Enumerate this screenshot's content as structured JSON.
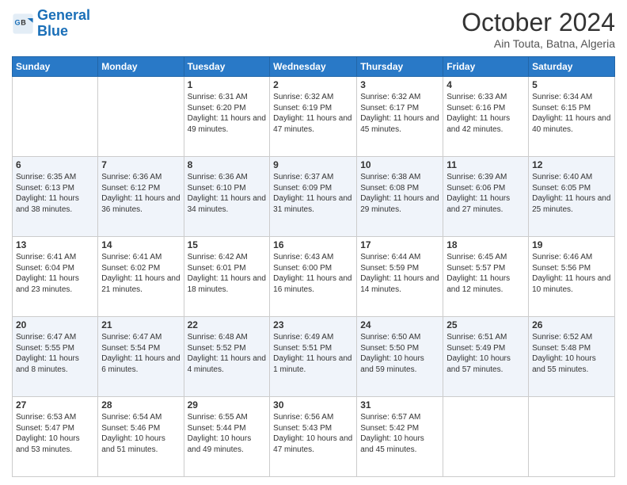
{
  "logo": {
    "line1": "General",
    "line2": "Blue"
  },
  "header": {
    "month": "October 2024",
    "location": "Ain Touta, Batna, Algeria"
  },
  "weekdays": [
    "Sunday",
    "Monday",
    "Tuesday",
    "Wednesday",
    "Thursday",
    "Friday",
    "Saturday"
  ],
  "weeks": [
    [
      {
        "day": "",
        "content": ""
      },
      {
        "day": "",
        "content": ""
      },
      {
        "day": "1",
        "content": "Sunrise: 6:31 AM\nSunset: 6:20 PM\nDaylight: 11 hours and 49 minutes."
      },
      {
        "day": "2",
        "content": "Sunrise: 6:32 AM\nSunset: 6:19 PM\nDaylight: 11 hours and 47 minutes."
      },
      {
        "day": "3",
        "content": "Sunrise: 6:32 AM\nSunset: 6:17 PM\nDaylight: 11 hours and 45 minutes."
      },
      {
        "day": "4",
        "content": "Sunrise: 6:33 AM\nSunset: 6:16 PM\nDaylight: 11 hours and 42 minutes."
      },
      {
        "day": "5",
        "content": "Sunrise: 6:34 AM\nSunset: 6:15 PM\nDaylight: 11 hours and 40 minutes."
      }
    ],
    [
      {
        "day": "6",
        "content": "Sunrise: 6:35 AM\nSunset: 6:13 PM\nDaylight: 11 hours and 38 minutes."
      },
      {
        "day": "7",
        "content": "Sunrise: 6:36 AM\nSunset: 6:12 PM\nDaylight: 11 hours and 36 minutes."
      },
      {
        "day": "8",
        "content": "Sunrise: 6:36 AM\nSunset: 6:10 PM\nDaylight: 11 hours and 34 minutes."
      },
      {
        "day": "9",
        "content": "Sunrise: 6:37 AM\nSunset: 6:09 PM\nDaylight: 11 hours and 31 minutes."
      },
      {
        "day": "10",
        "content": "Sunrise: 6:38 AM\nSunset: 6:08 PM\nDaylight: 11 hours and 29 minutes."
      },
      {
        "day": "11",
        "content": "Sunrise: 6:39 AM\nSunset: 6:06 PM\nDaylight: 11 hours and 27 minutes."
      },
      {
        "day": "12",
        "content": "Sunrise: 6:40 AM\nSunset: 6:05 PM\nDaylight: 11 hours and 25 minutes."
      }
    ],
    [
      {
        "day": "13",
        "content": "Sunrise: 6:41 AM\nSunset: 6:04 PM\nDaylight: 11 hours and 23 minutes."
      },
      {
        "day": "14",
        "content": "Sunrise: 6:41 AM\nSunset: 6:02 PM\nDaylight: 11 hours and 21 minutes."
      },
      {
        "day": "15",
        "content": "Sunrise: 6:42 AM\nSunset: 6:01 PM\nDaylight: 11 hours and 18 minutes."
      },
      {
        "day": "16",
        "content": "Sunrise: 6:43 AM\nSunset: 6:00 PM\nDaylight: 11 hours and 16 minutes."
      },
      {
        "day": "17",
        "content": "Sunrise: 6:44 AM\nSunset: 5:59 PM\nDaylight: 11 hours and 14 minutes."
      },
      {
        "day": "18",
        "content": "Sunrise: 6:45 AM\nSunset: 5:57 PM\nDaylight: 11 hours and 12 minutes."
      },
      {
        "day": "19",
        "content": "Sunrise: 6:46 AM\nSunset: 5:56 PM\nDaylight: 11 hours and 10 minutes."
      }
    ],
    [
      {
        "day": "20",
        "content": "Sunrise: 6:47 AM\nSunset: 5:55 PM\nDaylight: 11 hours and 8 minutes."
      },
      {
        "day": "21",
        "content": "Sunrise: 6:47 AM\nSunset: 5:54 PM\nDaylight: 11 hours and 6 minutes."
      },
      {
        "day": "22",
        "content": "Sunrise: 6:48 AM\nSunset: 5:52 PM\nDaylight: 11 hours and 4 minutes."
      },
      {
        "day": "23",
        "content": "Sunrise: 6:49 AM\nSunset: 5:51 PM\nDaylight: 11 hours and 1 minute."
      },
      {
        "day": "24",
        "content": "Sunrise: 6:50 AM\nSunset: 5:50 PM\nDaylight: 10 hours and 59 minutes."
      },
      {
        "day": "25",
        "content": "Sunrise: 6:51 AM\nSunset: 5:49 PM\nDaylight: 10 hours and 57 minutes."
      },
      {
        "day": "26",
        "content": "Sunrise: 6:52 AM\nSunset: 5:48 PM\nDaylight: 10 hours and 55 minutes."
      }
    ],
    [
      {
        "day": "27",
        "content": "Sunrise: 6:53 AM\nSunset: 5:47 PM\nDaylight: 10 hours and 53 minutes."
      },
      {
        "day": "28",
        "content": "Sunrise: 6:54 AM\nSunset: 5:46 PM\nDaylight: 10 hours and 51 minutes."
      },
      {
        "day": "29",
        "content": "Sunrise: 6:55 AM\nSunset: 5:44 PM\nDaylight: 10 hours and 49 minutes."
      },
      {
        "day": "30",
        "content": "Sunrise: 6:56 AM\nSunset: 5:43 PM\nDaylight: 10 hours and 47 minutes."
      },
      {
        "day": "31",
        "content": "Sunrise: 6:57 AM\nSunset: 5:42 PM\nDaylight: 10 hours and 45 minutes."
      },
      {
        "day": "",
        "content": ""
      },
      {
        "day": "",
        "content": ""
      }
    ]
  ]
}
